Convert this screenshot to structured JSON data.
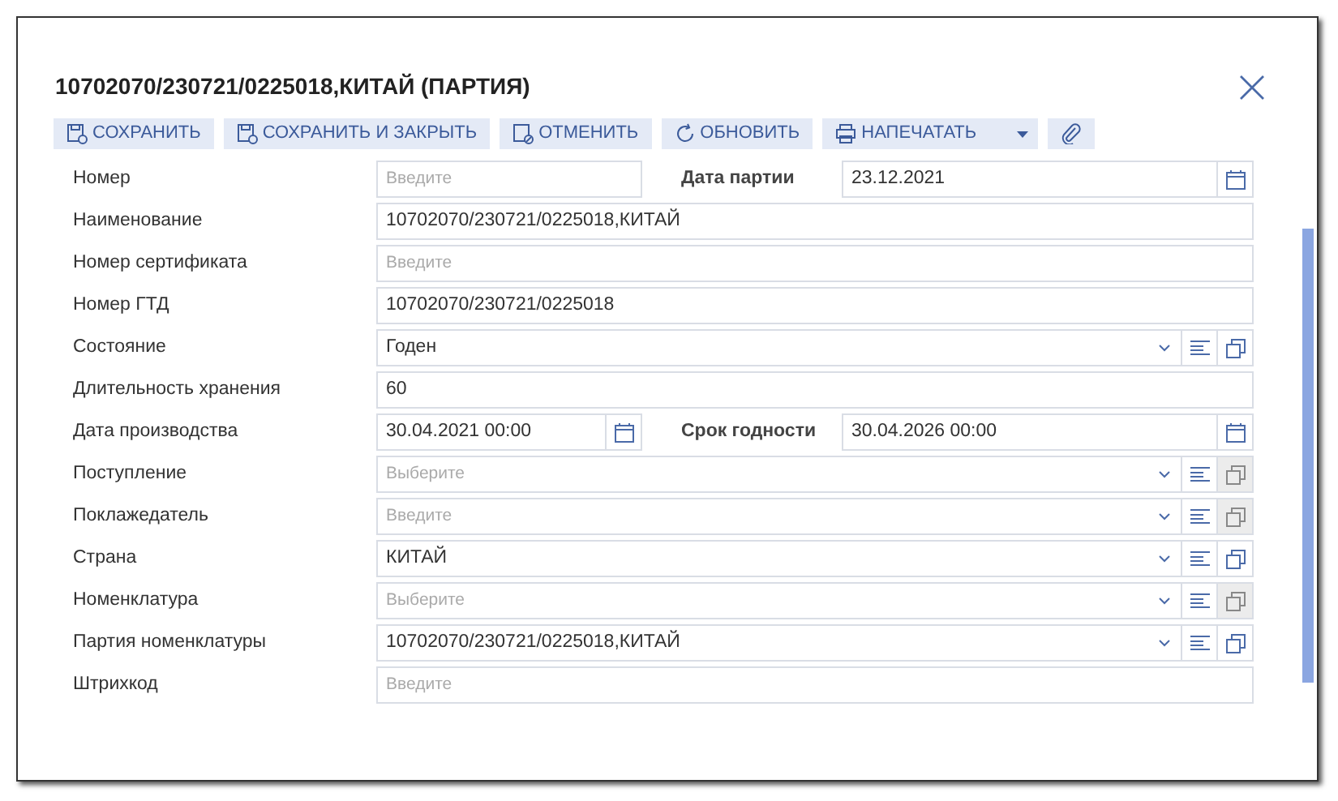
{
  "dialog": {
    "title": "10702070/230721/0225018,КИТАЙ (ПАРТИЯ)"
  },
  "toolbar": [
    {
      "kind": "save",
      "label": "СОХРАНИТЬ"
    },
    {
      "kind": "save-close",
      "label": "СОХРАНИТЬ И ЗАКРЫТЬ"
    },
    {
      "kind": "cancel",
      "label": "ОТМЕНИТЬ"
    },
    {
      "kind": "refresh",
      "label": "ОБНОВИТЬ"
    },
    {
      "kind": "print",
      "label": "НАПЕЧАТАТЬ"
    },
    {
      "kind": "attach"
    }
  ],
  "fields": [
    {
      "kind": "pair",
      "label": "Номер",
      "left": {
        "kind": "text",
        "placeholder": "Введите"
      },
      "label_2": "Дата партии",
      "right": {
        "kind": "date",
        "value": "23.12.2021"
      }
    },
    {
      "kind": "text",
      "label": "Наименование",
      "value": "10702070/230721/0225018,КИТАЙ"
    },
    {
      "kind": "text",
      "label": "Номер сертификата",
      "placeholder": "Введите"
    },
    {
      "kind": "text",
      "label": "Номер ГТД",
      "value": "10702070/230721/0225018"
    },
    {
      "kind": "select",
      "label": "Состояние",
      "value": "Годен",
      "open_disabled": false
    },
    {
      "kind": "text",
      "label": "Длительность хранения",
      "value": "60"
    },
    {
      "kind": "pair",
      "label": "Дата производства",
      "left": {
        "kind": "date",
        "value": "30.04.2021 00:00"
      },
      "label_2": "Срок годности",
      "right": {
        "kind": "date",
        "value": "30.04.2026 00:00"
      }
    },
    {
      "kind": "select",
      "label": "Поступление",
      "placeholder": "Выберите",
      "open_disabled": true
    },
    {
      "kind": "select",
      "label": "Поклажедатель",
      "placeholder": "Введите",
      "open_disabled": true
    },
    {
      "kind": "select",
      "label": "Страна",
      "value": "КИТАЙ",
      "open_disabled": false
    },
    {
      "kind": "select",
      "label": "Номенклатура",
      "placeholder": "Выберите",
      "open_disabled": true
    },
    {
      "kind": "select",
      "label": "Партия номенклатуры",
      "value": "10702070/230721/0225018,КИТАЙ",
      "open_disabled": false
    },
    {
      "kind": "text",
      "label": "Штрихкод",
      "placeholder": "Введите"
    }
  ]
}
